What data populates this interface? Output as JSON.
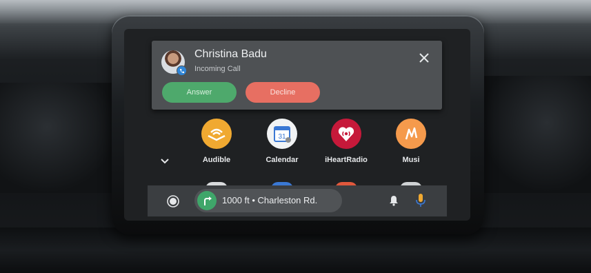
{
  "notification": {
    "caller_name": "Christina Badu",
    "status": "Incoming Call",
    "answer_label": "Answer",
    "decline_label": "Decline"
  },
  "apps": [
    {
      "label": "Audible",
      "icon": "audible-icon",
      "color": "#f0a931"
    },
    {
      "label": "Calendar",
      "icon": "calendar-icon",
      "color": "#f1f3f4",
      "day": "31"
    },
    {
      "label": "iHeartRadio",
      "icon": "iheartradio-icon",
      "color": "#c6193a"
    },
    {
      "label": "Musi",
      "icon": "musi-icon",
      "color": "#f59a4c"
    }
  ],
  "navbar": {
    "navigation_text": "1000 ft • Charleston Rd.",
    "icons": [
      "home-icon",
      "turn-right-icon",
      "bell-icon",
      "mic-icon"
    ]
  },
  "colors": {
    "answer": "#4ea96c",
    "decline": "#e76f62",
    "card": "#4e5154",
    "navbar": "#3b3e41",
    "turn": "#3fa66a",
    "mic": "#f0a931"
  }
}
